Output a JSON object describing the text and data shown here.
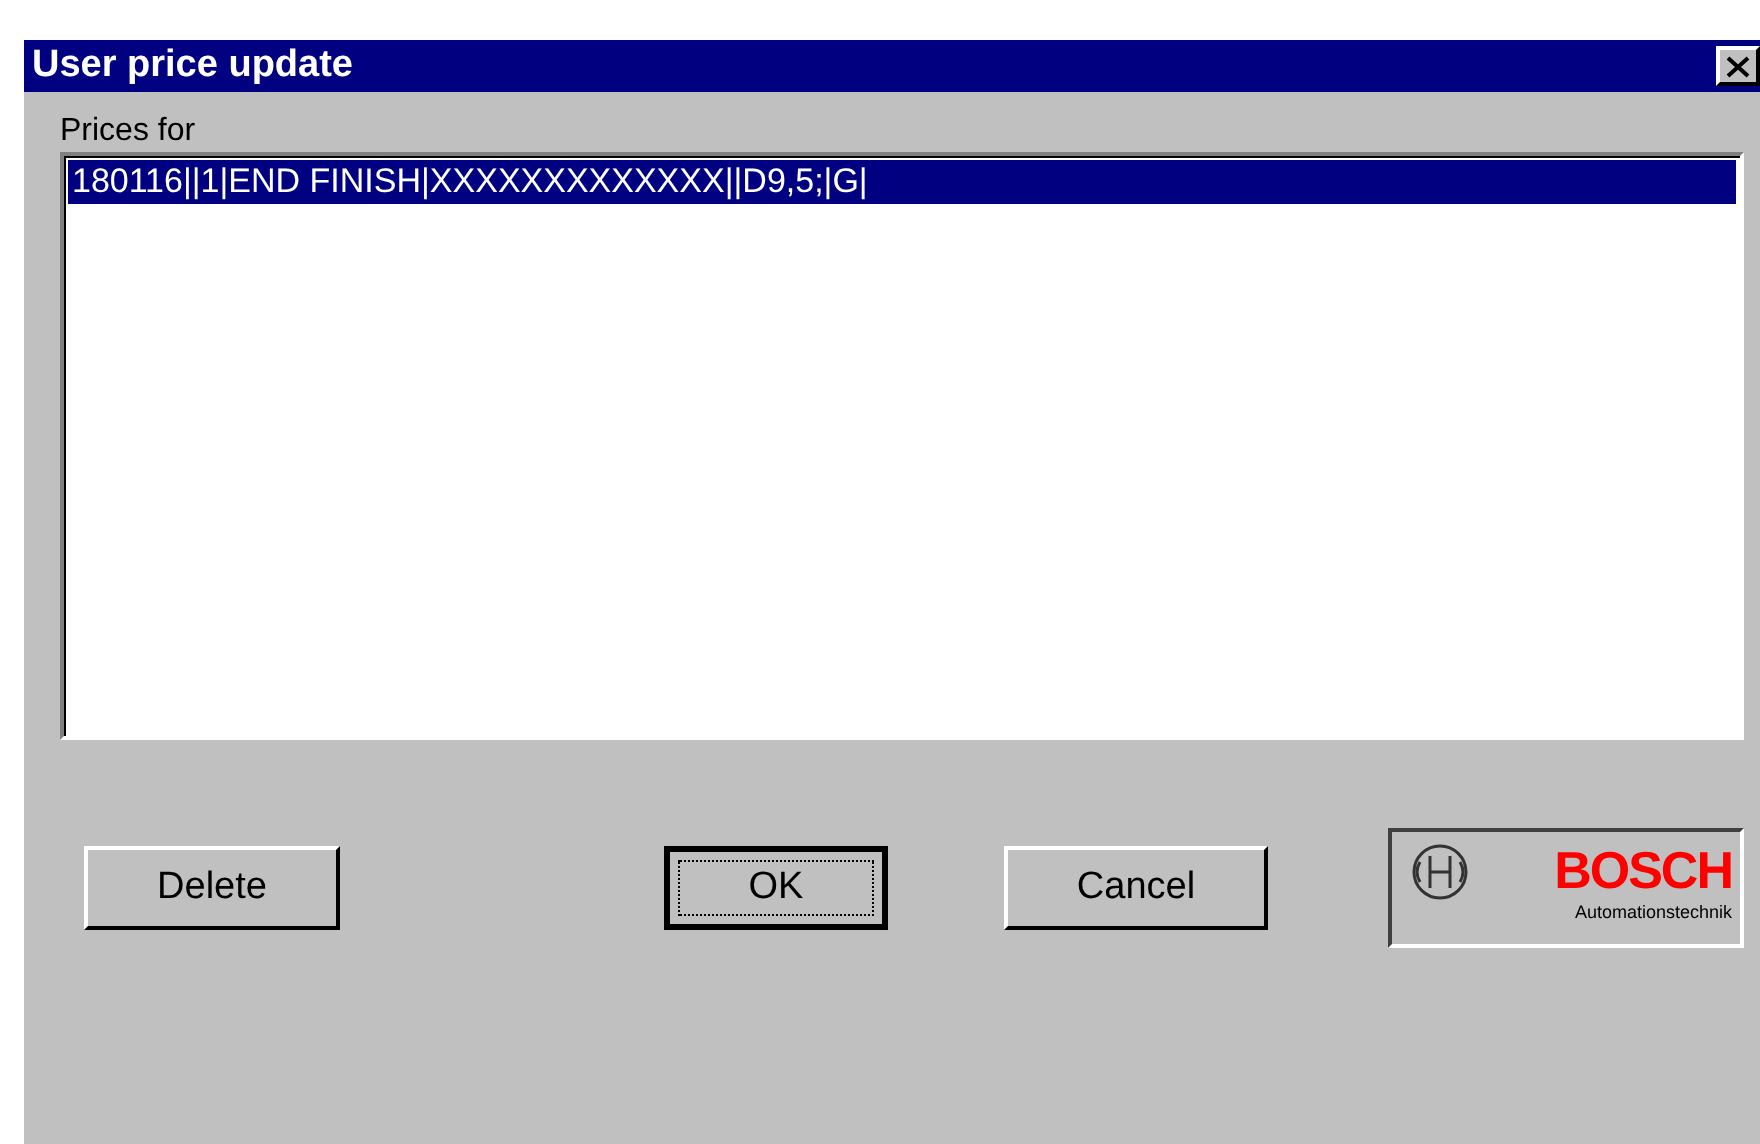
{
  "window": {
    "title": "User price update"
  },
  "list": {
    "label": "Prices for",
    "items": [
      {
        "text": "180116||1|END FINISH|XXXXXXXXXXXXX||D9,5;|G|",
        "selected": true
      }
    ]
  },
  "buttons": [
    {
      "label": "Delete",
      "default": false
    },
    {
      "label": "OK",
      "default": true
    },
    {
      "label": "Cancel",
      "default": false
    }
  ],
  "logo": {
    "brand": "BOSCH",
    "tagline": "Automationstechnik"
  }
}
